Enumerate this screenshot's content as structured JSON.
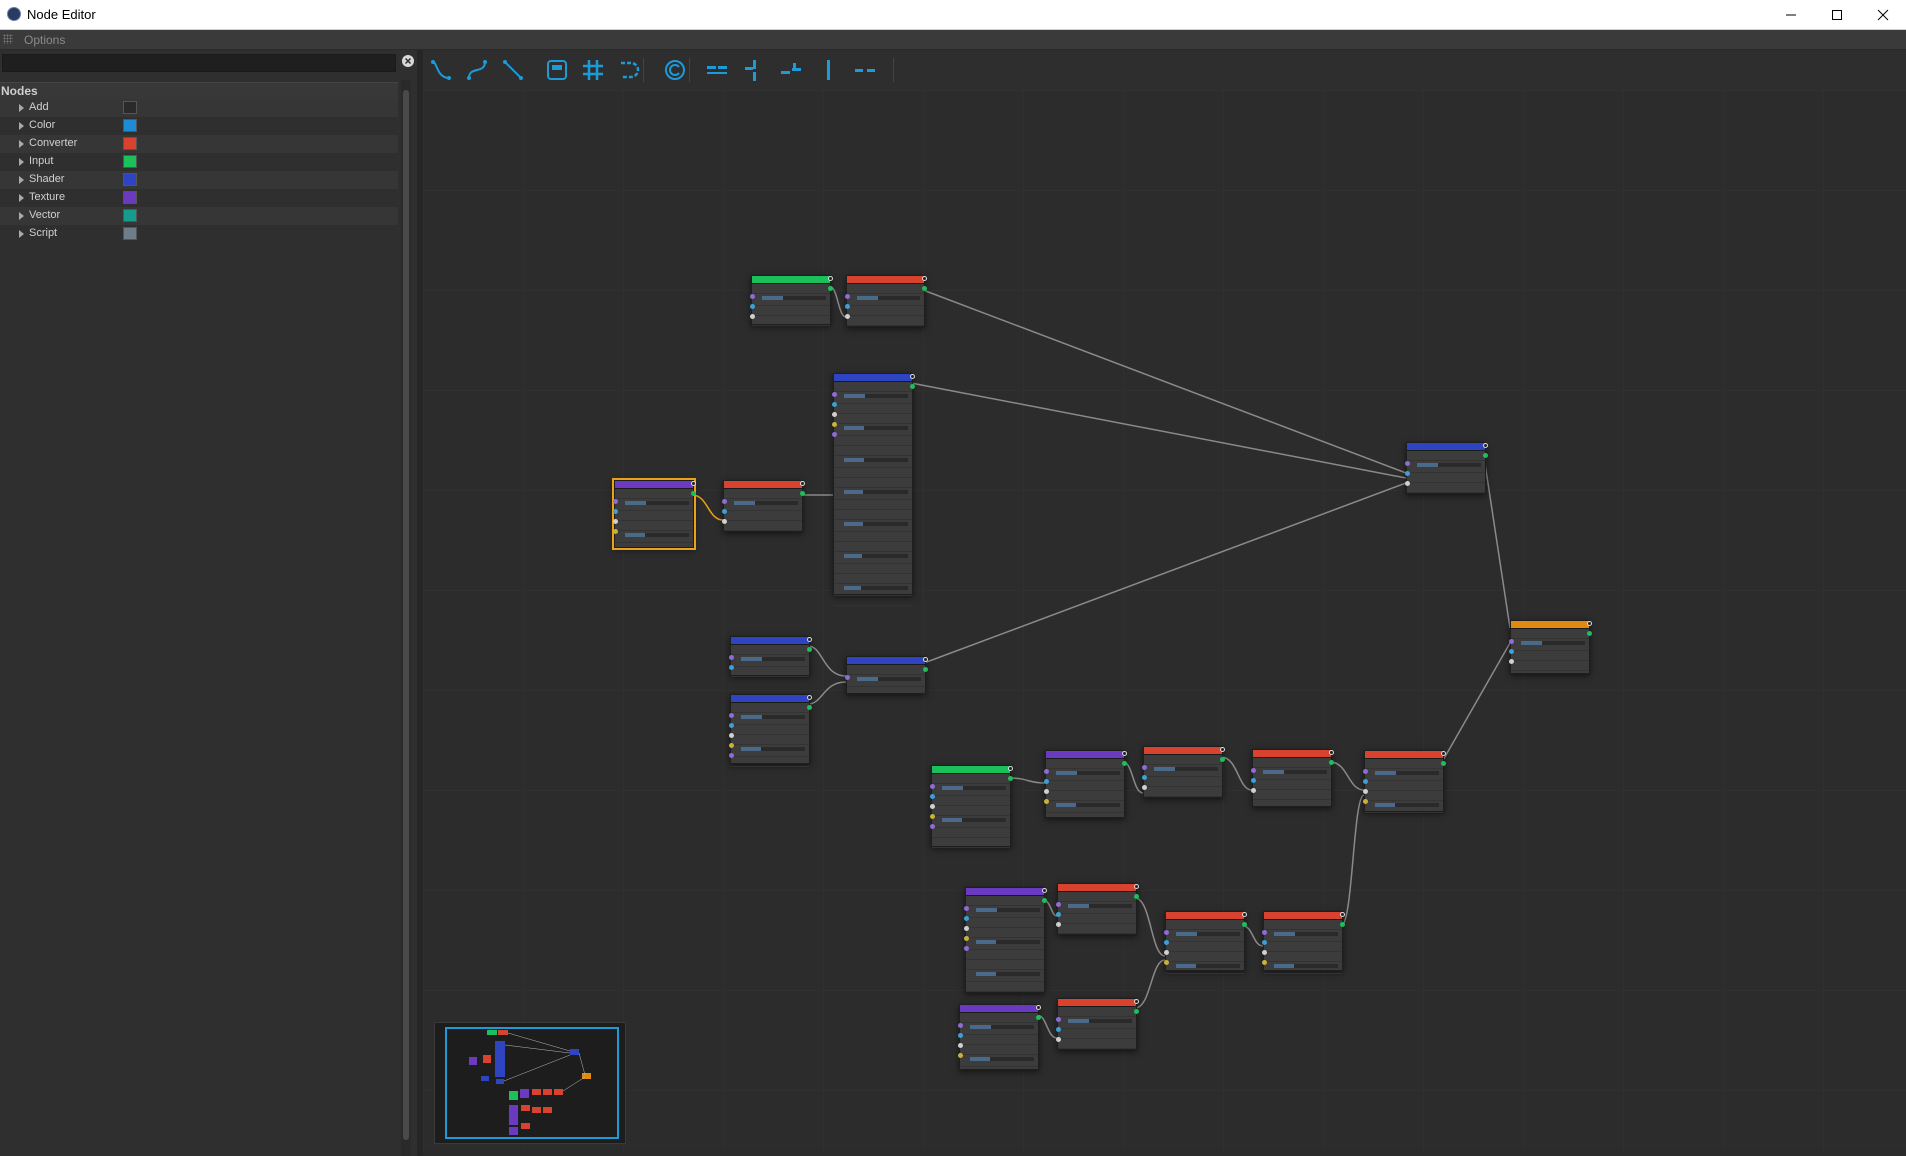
{
  "window": {
    "title": "Node Editor"
  },
  "menu": {
    "options_label": "Options"
  },
  "panel": {
    "header": "Nodes",
    "categories": [
      {
        "label": "Add",
        "color": "#2a2a2a"
      },
      {
        "label": "Color",
        "color": "#1f8ad6"
      },
      {
        "label": "Converter",
        "color": "#d8432f"
      },
      {
        "label": "Input",
        "color": "#1bc05a"
      },
      {
        "label": "Shader",
        "color": "#2f44c0"
      },
      {
        "label": "Texture",
        "color": "#6a3bc0"
      },
      {
        "label": "Vector",
        "color": "#169b8f"
      },
      {
        "label": "Script",
        "color": "#6d7d8a"
      }
    ]
  },
  "toolbar": {
    "icons": [
      "curve-spline-icon",
      "curve-bezier-icon",
      "curve-straight-icon",
      "frame-icon",
      "grid-icon",
      "route-icon",
      "refresh-icon",
      "align-top-icon",
      "align-center-icon",
      "align-bottom-icon",
      "align-vertical-icon",
      "distribute-icon"
    ]
  },
  "colors": {
    "accent": "#1d9bd8",
    "selected_outline": "#e9a21a",
    "input_header": "#1bc05a",
    "converter_header": "#d8432f",
    "shader_header": "#2f44c0",
    "texture_header": "#6a3bc0",
    "output_header": "#e08a10"
  }
}
